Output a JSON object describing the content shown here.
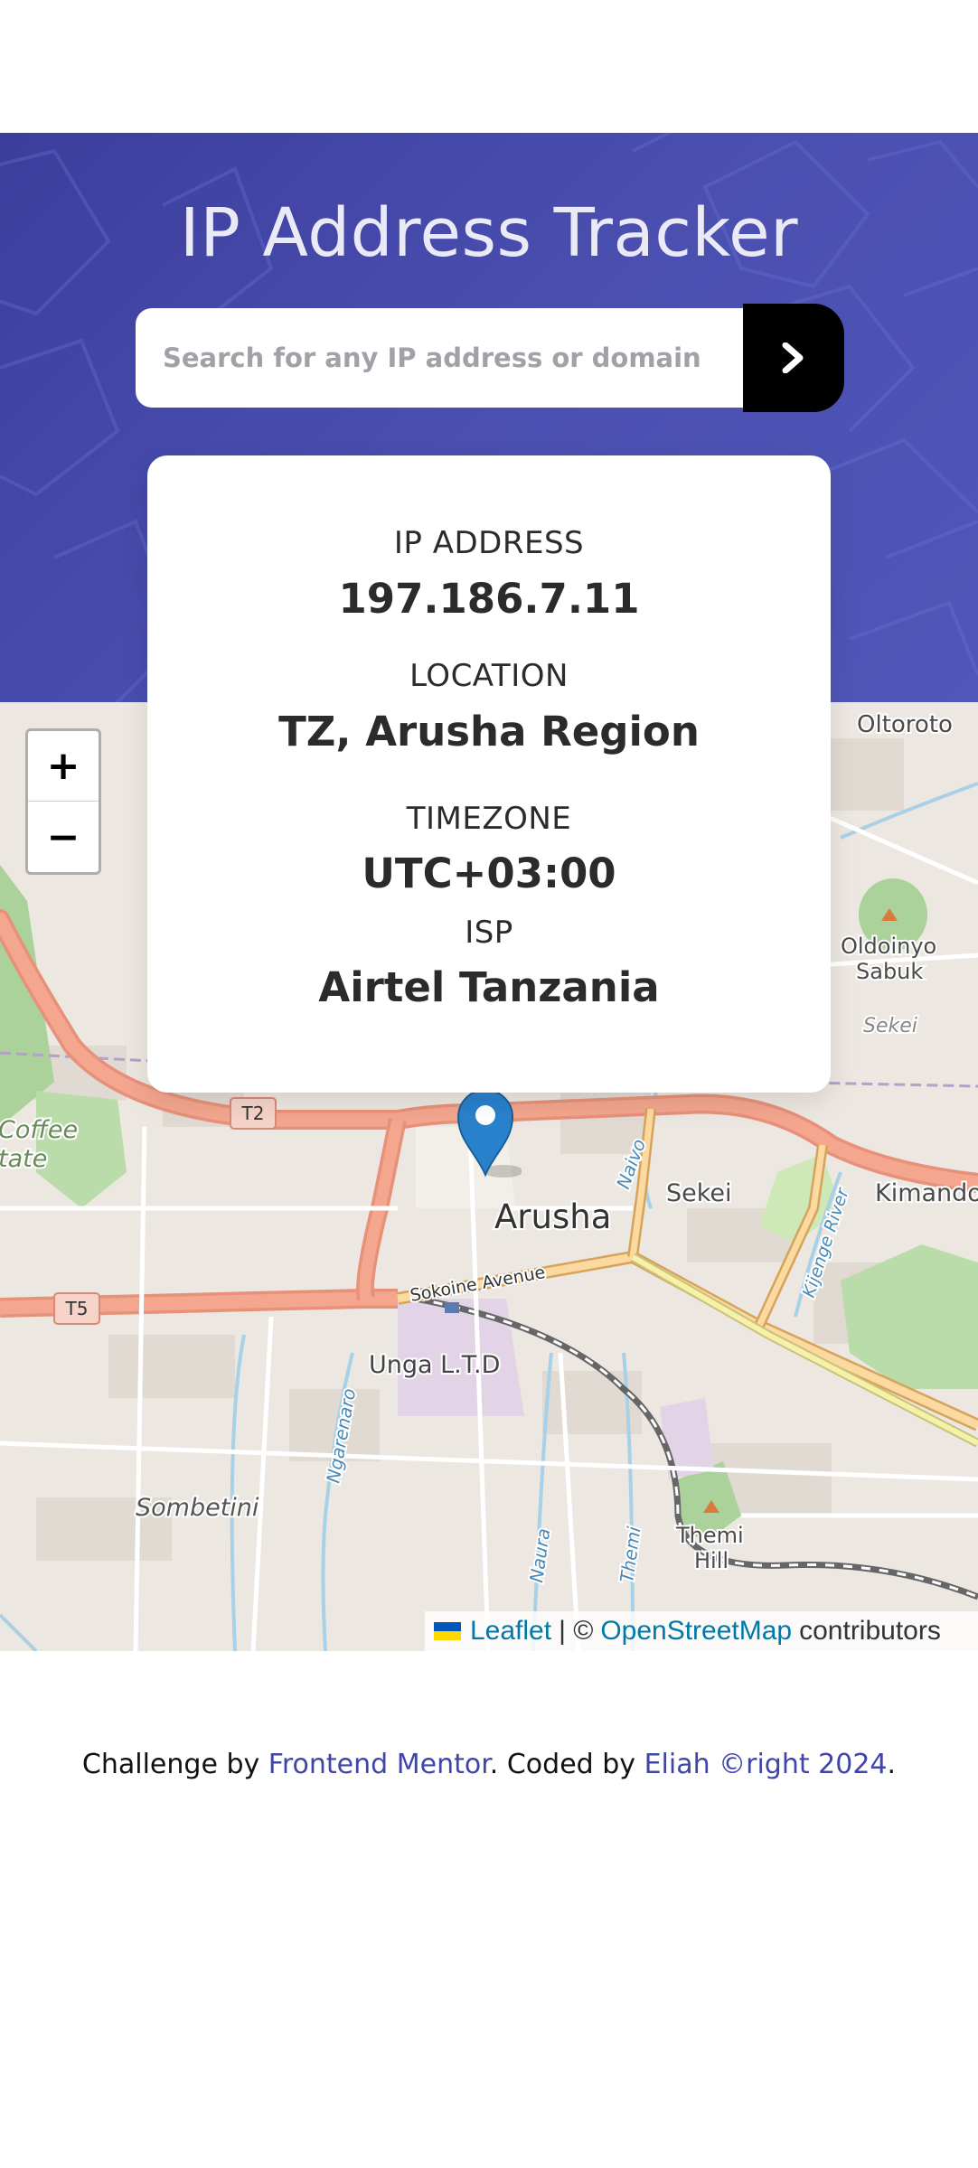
{
  "header": {
    "title": "IP Address Tracker",
    "search": {
      "placeholder": "Search for any IP address or domain",
      "value": ""
    },
    "submit_icon": "chevron-right-icon"
  },
  "info": {
    "ip": {
      "label": "IP ADDRESS",
      "value": "197.186.7.11"
    },
    "location": {
      "label": "LOCATION",
      "value": "TZ, Arusha Region"
    },
    "timezone": {
      "label": "TIMEZONE",
      "value": "UTC+03:00"
    },
    "isp": {
      "label": "ISP",
      "value": "Airtel Tanzania"
    }
  },
  "map": {
    "zoom_in": "+",
    "zoom_out": "−",
    "labels": {
      "oltoroto": "Oltoroto",
      "oldoinyo_1": "Oldoinyo",
      "oldoinyo_2": "Sabuk",
      "sekei_top": "Sekei",
      "kimandolu": "Kimando",
      "coffee_1": "Coffee",
      "coffee_2": "tate",
      "t2": "T2",
      "t5": "T5",
      "naivo": "Naivo",
      "sekei": "Sekei",
      "arusha": "Arusha",
      "kijenge": "Kijenge River",
      "sokoine": "Sokoine Avenue",
      "unga": "Unga L.T.D",
      "ngarenaro": "Ngarenaro",
      "sombetini": "Sombetini",
      "naura": "Naura",
      "themi": "Themi",
      "themi_hill_1": "Themi",
      "themi_hill_2": "Hill"
    },
    "attribution": {
      "leaflet": "Leaflet",
      "separator": "| ©",
      "osm": "OpenStreetMap",
      "suffix": "contributors"
    }
  },
  "footer": {
    "prefix": "Challenge by",
    "mentor": "Frontend Mentor",
    "middle": ". Coded by",
    "author": "Eliah ©right 2024",
    "suffix": "."
  },
  "colors": {
    "header_bg": "#4a4fb0",
    "accent_link": "#3f46a8",
    "leaflet_link": "#0078a8",
    "marker": "#2a81cb"
  }
}
